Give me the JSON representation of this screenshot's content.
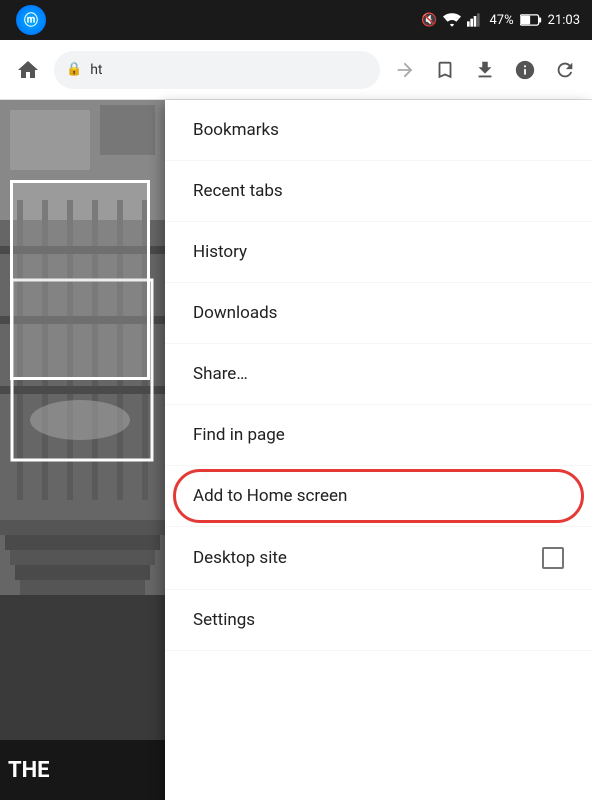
{
  "status_bar": {
    "left_icon": "messenger",
    "right": {
      "mute_icon": "🔇",
      "wifi_icon": "wifi",
      "signal_icon": "signal",
      "battery": "47%",
      "time": "21:03"
    }
  },
  "browser_toolbar": {
    "home_icon": "⌂",
    "address": "ht",
    "secure_icon": "🔒",
    "forward_icon": "→",
    "star_icon": "☆",
    "download_icon": "⬇",
    "info_icon": "ⓘ",
    "refresh_icon": "↻"
  },
  "page": {
    "bottom_text": "THE"
  },
  "menu": {
    "items": [
      {
        "label": "Bookmarks",
        "id": "bookmarks",
        "has_checkbox": false
      },
      {
        "label": "Recent tabs",
        "id": "recent-tabs",
        "has_checkbox": false
      },
      {
        "label": "History",
        "id": "history",
        "has_checkbox": false
      },
      {
        "label": "Downloads",
        "id": "downloads",
        "has_checkbox": false
      },
      {
        "label": "Share…",
        "id": "share",
        "has_checkbox": false
      },
      {
        "label": "Find in page",
        "id": "find-in-page",
        "has_checkbox": false
      },
      {
        "label": "Add to Home screen",
        "id": "add-to-home-screen",
        "has_checkbox": false,
        "highlighted": true
      },
      {
        "label": "Desktop site",
        "id": "desktop-site",
        "has_checkbox": true
      },
      {
        "label": "Settings",
        "id": "settings",
        "has_checkbox": false
      }
    ]
  }
}
